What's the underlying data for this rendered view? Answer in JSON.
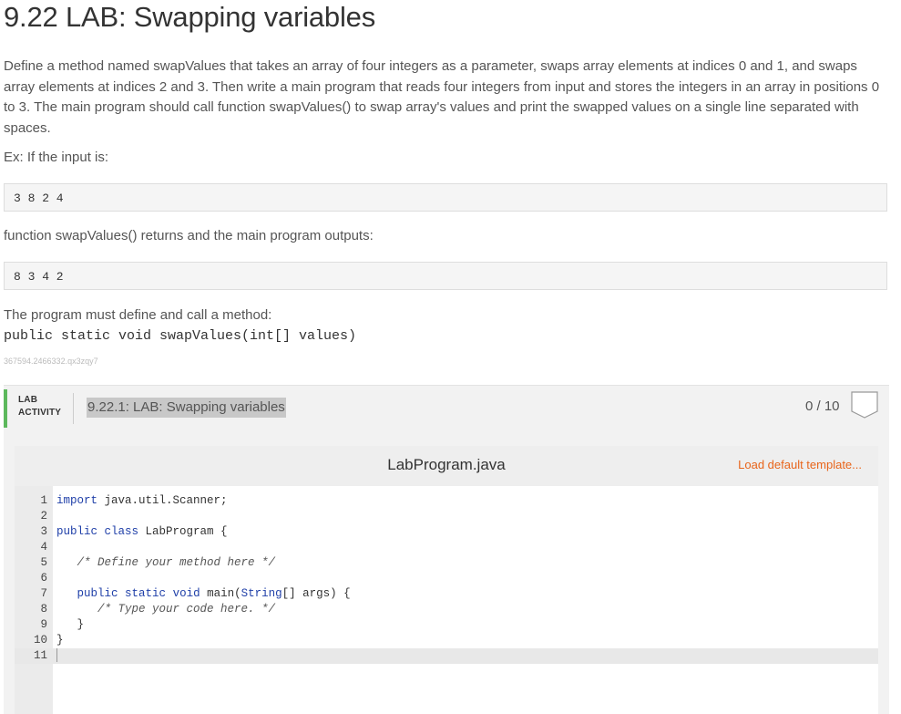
{
  "title": "9.22 LAB: Swapping variables",
  "description": "Define a method named swapValues that takes an array of four integers as a parameter, swaps array elements at indices 0 and 1, and swaps array elements at indices 2 and 3. Then write a main program that reads four integers from input and stores the integers in an array in positions 0 to 3. The main program should call function swapValues() to swap array's values and print the swapped values on a single line separated with spaces.",
  "example_intro": "Ex: If the input is:",
  "example_input": "3 8 2 4",
  "example_mid": "function swapValues() returns and the main program outputs:",
  "example_output": "8 3 4 2",
  "requirement_text": "The program must define and call a method:",
  "method_signature": "public static void swapValues(int[] values)",
  "tracking_id": "367594.2466332.qx3zqy7",
  "lab": {
    "tag_line1": "LAB",
    "tag_line2": "ACTIVITY",
    "title": "9.22.1: LAB: Swapping variables",
    "score": "0 / 10",
    "accent_color": "#5cb85c"
  },
  "editor": {
    "file_name": "LabProgram.java",
    "load_template_label": "Load default template...",
    "link_color": "#e8651b",
    "lines": [
      {
        "n": "1",
        "code": "import java.util.Scanner;"
      },
      {
        "n": "2",
        "code": ""
      },
      {
        "n": "3",
        "code": "public class LabProgram {"
      },
      {
        "n": "4",
        "code": ""
      },
      {
        "n": "5",
        "code": "   /* Define your method here */"
      },
      {
        "n": "6",
        "code": ""
      },
      {
        "n": "7",
        "code": "   public static void main(String[] args) {"
      },
      {
        "n": "8",
        "code": "      /* Type your code here. */"
      },
      {
        "n": "9",
        "code": "   }"
      },
      {
        "n": "10",
        "code": "}"
      },
      {
        "n": "11",
        "code": ""
      }
    ]
  }
}
